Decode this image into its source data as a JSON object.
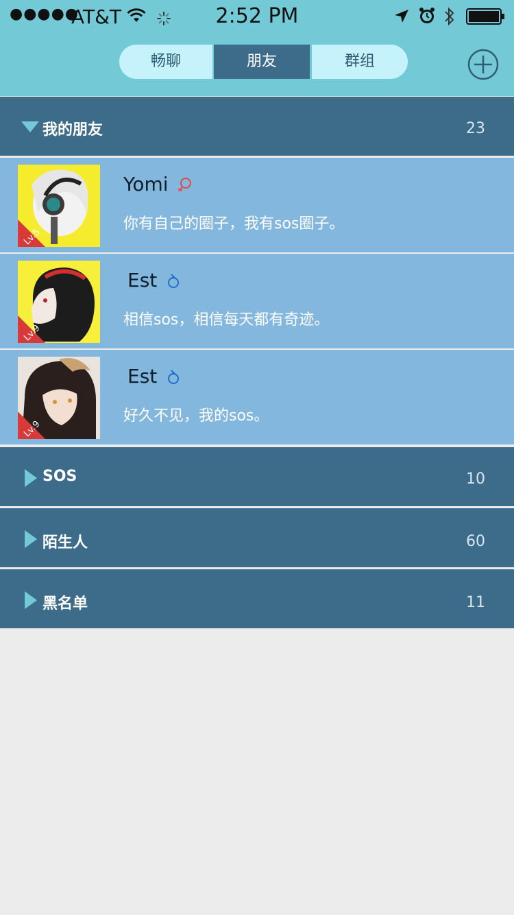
{
  "status": {
    "signal": "●●●●●",
    "carrier": "AT&T",
    "time": "2:52 PM"
  },
  "tabs": [
    {
      "label": "畅聊"
    },
    {
      "label": "朋友"
    },
    {
      "label": "群组"
    }
  ],
  "active_tab": "朋友",
  "groups": [
    {
      "name": "我的朋友",
      "count": "23",
      "expanded": true
    },
    {
      "name": "SOS",
      "count": "10",
      "expanded": false
    },
    {
      "name": "陌生人",
      "count": "60",
      "expanded": false
    },
    {
      "name": "黑名单",
      "count": "11",
      "expanded": false
    }
  ],
  "friends": [
    {
      "name": "Yomi",
      "gender": "female",
      "level": "Lv.5",
      "signature": "你有自己的圈子，我有sos圈子。"
    },
    {
      "name": "Est",
      "gender": "male",
      "level": "Lv.9",
      "signature": "相信sos，相信每天都有奇迹。"
    },
    {
      "name": "Est",
      "gender": "male",
      "level": "Lv.9",
      "signature": "好久不见，我的sos。"
    }
  ],
  "colors": {
    "header_bg": "#73cad6",
    "group_bg": "#3d6c8a",
    "friend_bg": "#84b7dd",
    "tab_inactive": "#c6f3fb",
    "female": "#e04a4a",
    "male": "#1f6fc4"
  }
}
